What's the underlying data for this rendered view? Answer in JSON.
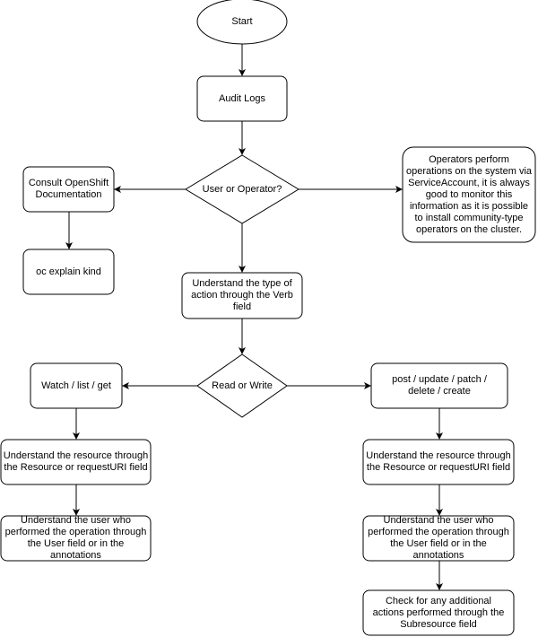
{
  "diagram": {
    "type": "flowchart",
    "colors": {
      "stroke": "#000000",
      "fill": "#ffffff",
      "text": "#000000"
    },
    "nodes": {
      "start": {
        "shape": "ellipse",
        "label": "Start"
      },
      "audit_logs": {
        "shape": "rounded-rect",
        "label": "Audit Logs"
      },
      "user_or_operator": {
        "shape": "diamond",
        "label": "User or Operator?"
      },
      "consult_docs": {
        "shape": "rounded-rect",
        "label": "Consult OpenShift Documentation"
      },
      "oc_explain": {
        "shape": "rounded-rect",
        "label": "oc explain kind"
      },
      "operators_note": {
        "shape": "rounded-rect",
        "label": "Operators perform operations on the system via ServiceAccount, it is always good to monitor this information as it is possible to install community-type operators on the cluster."
      },
      "verb_field": {
        "shape": "rounded-rect",
        "label": "Understand the type of action through the Verb field"
      },
      "read_or_write": {
        "shape": "diamond",
        "label": "Read or Write"
      },
      "read_verbs": {
        "shape": "rounded-rect",
        "label": "Watch / list / get"
      },
      "write_verbs": {
        "shape": "rounded-rect",
        "label": "post / update / patch / delete / create"
      },
      "read_resource": {
        "shape": "rounded-rect",
        "label": "Understand the resource through the Resource or requestURI field"
      },
      "read_user": {
        "shape": "rounded-rect",
        "label": "Understand the user who performed the operation through the User field or in the annotations"
      },
      "write_resource": {
        "shape": "rounded-rect",
        "label": "Understand the resource through the Resource or requestURI field"
      },
      "write_user": {
        "shape": "rounded-rect",
        "label": "Understand the user who performed the operation through the User field or in the annotations"
      },
      "subresource": {
        "shape": "rounded-rect",
        "label": "Check for any additional actions performed through the Subresource field"
      }
    },
    "edges": [
      {
        "from": "start",
        "to": "audit_logs"
      },
      {
        "from": "audit_logs",
        "to": "user_or_operator"
      },
      {
        "from": "user_or_operator",
        "to": "consult_docs"
      },
      {
        "from": "user_or_operator",
        "to": "operators_note"
      },
      {
        "from": "user_or_operator",
        "to": "verb_field"
      },
      {
        "from": "consult_docs",
        "to": "oc_explain"
      },
      {
        "from": "verb_field",
        "to": "read_or_write"
      },
      {
        "from": "read_or_write",
        "to": "read_verbs"
      },
      {
        "from": "read_or_write",
        "to": "write_verbs"
      },
      {
        "from": "read_verbs",
        "to": "read_resource"
      },
      {
        "from": "read_resource",
        "to": "read_user"
      },
      {
        "from": "write_verbs",
        "to": "write_resource"
      },
      {
        "from": "write_resource",
        "to": "write_user"
      },
      {
        "from": "write_user",
        "to": "subresource"
      }
    ]
  }
}
